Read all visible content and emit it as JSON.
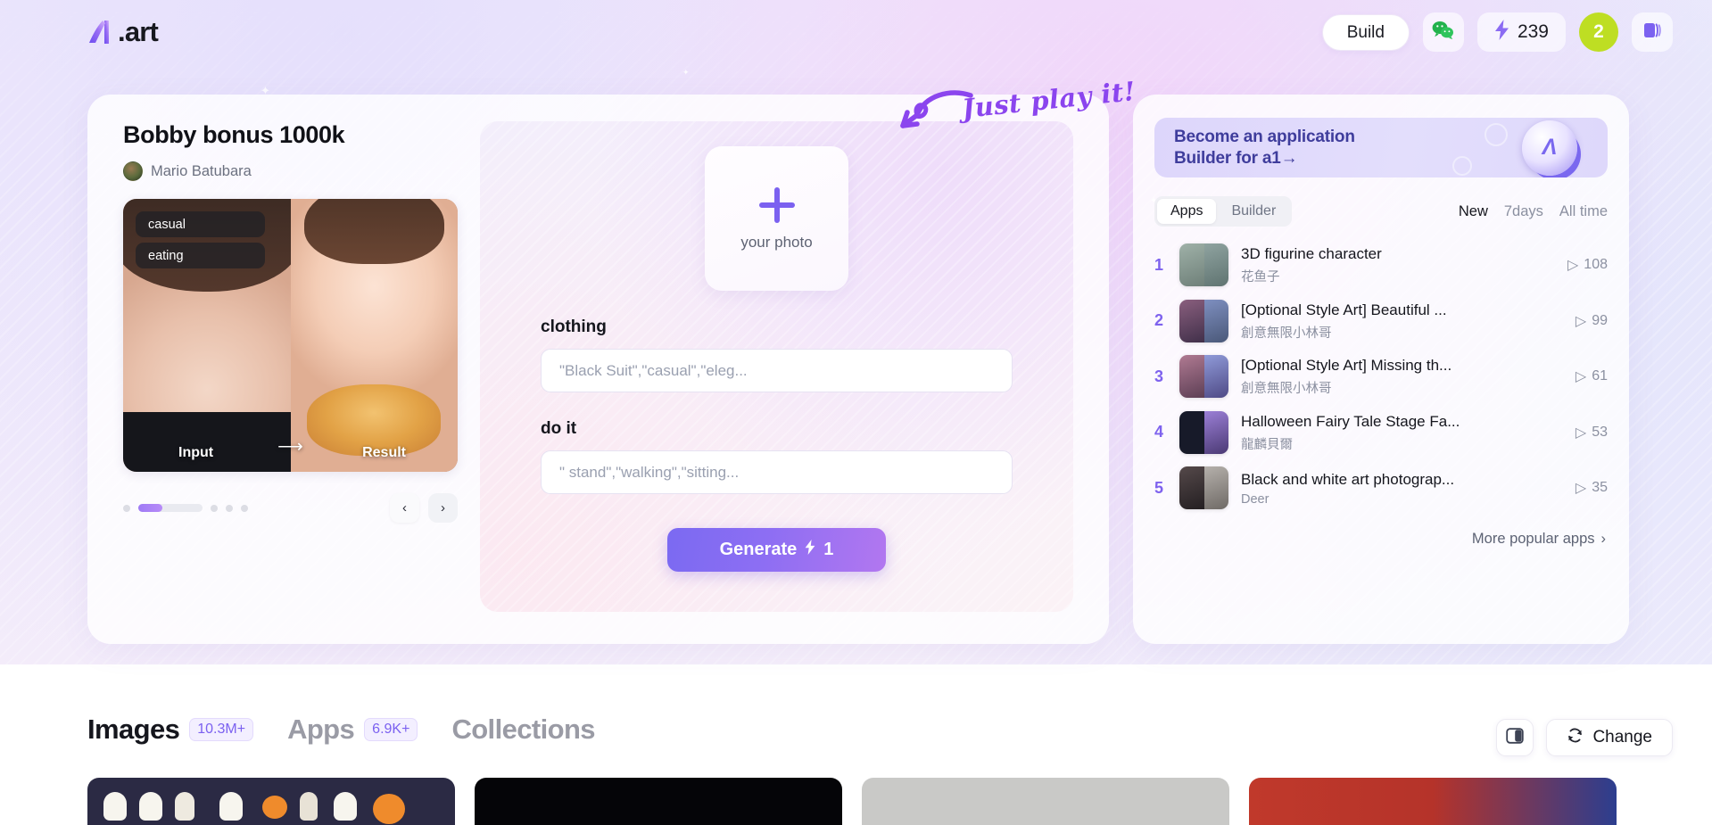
{
  "header": {
    "logo_text": ".art",
    "logo_icon": "a1-logo-icon",
    "build_label": "Build",
    "wechat_icon": "wechat-icon",
    "bolt_icon": "lightning-bolt-icon",
    "credits": "239",
    "avatar_badge": "2",
    "panel_icon": "book-panel-icon"
  },
  "hero": {
    "title": "Bobby bonus 1000k",
    "author": "Mario Batubara",
    "tags": [
      "casual",
      "eating"
    ],
    "input_label": "Input",
    "result_label": "Result",
    "arrow_glyph": "⟶",
    "prev_icon": "chevron-left-icon",
    "next_icon": "chevron-right-icon"
  },
  "annotation": {
    "text": "Just play it!",
    "arrow_icon": "curved-arrow-left-icon"
  },
  "form": {
    "upload_label": "your photo",
    "plus_icon": "plus-icon",
    "fields": [
      {
        "label": "clothing",
        "placeholder": "\"Black Suit\",\"casual\",\"eleg...",
        "value": ""
      },
      {
        "label": "do it",
        "placeholder": "\" stand\",\"walking\",\"sitting...",
        "value": ""
      }
    ],
    "generate_label": "Generate",
    "generate_cost": "1",
    "generate_icon": "lightning-bolt-icon"
  },
  "sidebar": {
    "promo_text": "Become an application\nBuilder for a1→",
    "promo_icon": "a1-coin-icon",
    "tabs": [
      {
        "label": "Apps",
        "active": true
      },
      {
        "label": "Builder",
        "active": false
      }
    ],
    "filters": [
      {
        "label": "New",
        "active": true
      },
      {
        "label": "7days",
        "active": false
      },
      {
        "label": "All time",
        "active": false
      }
    ],
    "ranks": [
      {
        "num": "1",
        "title": "3D figurine character",
        "author": "花鱼子",
        "plays": "108",
        "c1": "#8a9fa0",
        "c2": "#7f9195"
      },
      {
        "num": "2",
        "title": "[Optional Style Art] Beautiful ...",
        "author": "創意無限小林哥",
        "plays": "99",
        "c1": "#6b4a63",
        "c2": "#5a6f93"
      },
      {
        "num": "3",
        "title": "[Optional Style Art] Missing th...",
        "author": "創意無限小林哥",
        "plays": "61",
        "c1": "#7a5a6e",
        "c2": "#6d7ba8"
      },
      {
        "num": "4",
        "title": "Halloween Fairy Tale Stage Fa...",
        "author": "龍麟貝爾",
        "plays": "53",
        "c1": "#181a28",
        "c2": "#6b53a0"
      },
      {
        "num": "5",
        "title": "Black and white art photograp...",
        "author": "Deer",
        "plays": "35",
        "c1": "#3c3a3c",
        "c2": "#8d8a87"
      }
    ],
    "play_icon": "play-triangle-icon",
    "more_label": "More popular apps",
    "more_icon": "chevron-right-icon"
  },
  "bottom": {
    "tabs": [
      {
        "label": "Images",
        "count": "10.3M+",
        "active": true
      },
      {
        "label": "Apps",
        "count": "6.9K+",
        "active": false
      },
      {
        "label": "Collections",
        "count": "",
        "active": false
      }
    ],
    "layout_icon": "split-layout-icon",
    "change_label": "Change",
    "change_icon": "refresh-icon"
  },
  "colors": {
    "accent": "#7b61f0",
    "accent_gradient_end": "#b277f0",
    "badge_green": "#bede23",
    "annotation_purple": "#8b45ee",
    "promo_text": "#3f3d9c"
  }
}
